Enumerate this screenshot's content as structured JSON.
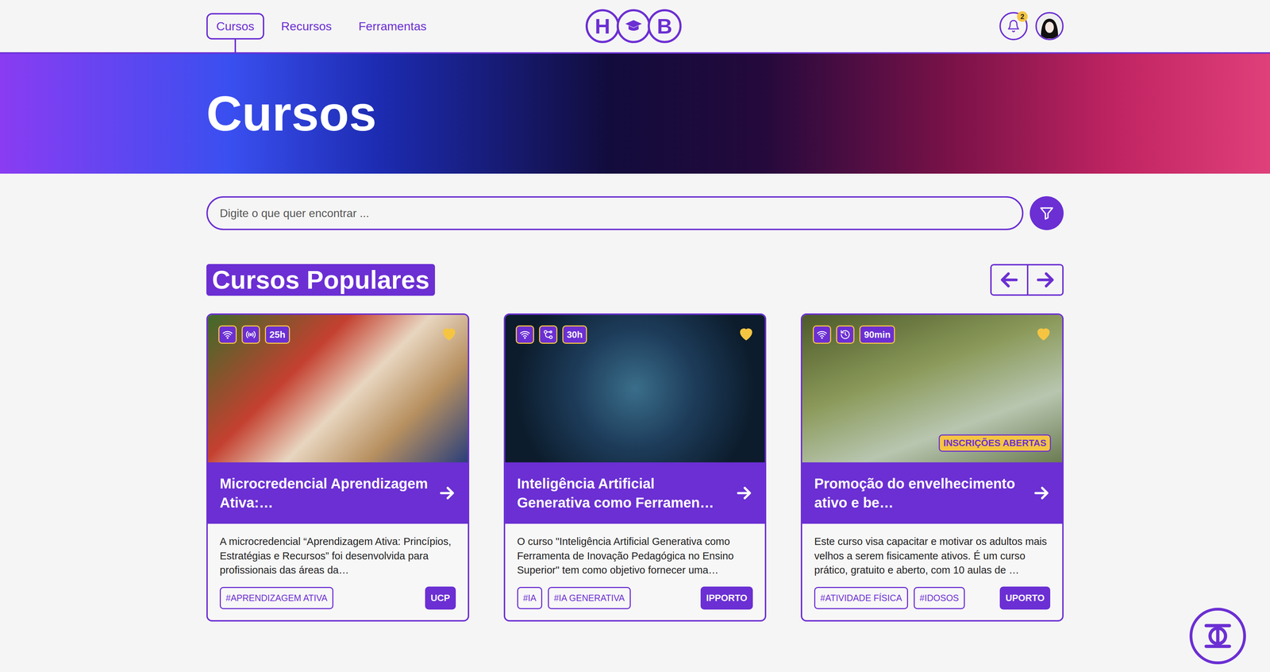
{
  "header": {
    "tabs": [
      {
        "label": "Cursos",
        "selected": true
      },
      {
        "label": "Recursos",
        "selected": false
      },
      {
        "label": "Ferramentas",
        "selected": false
      }
    ],
    "logo": {
      "left": "H",
      "right": "B"
    },
    "notifications": {
      "count": "2"
    }
  },
  "hero": {
    "title": "Cursos"
  },
  "search": {
    "placeholder": "Digite o que quer encontrar ..."
  },
  "section": {
    "title": "Cursos Populares"
  },
  "courses": [
    {
      "badges": [
        {
          "kind": "wifi",
          "text": ""
        },
        {
          "kind": "broadcast",
          "text": ""
        },
        {
          "kind": "duration",
          "text": "25h"
        }
      ],
      "favorite": true,
      "status": "",
      "title": "Microcredencial Aprendizagem Ativa:…",
      "description": "A microcredencial “Aprendizagem Ativa: Princípios, Estratégias e Recursos” foi desenvolvida para profissionais das áreas da…",
      "tags": [
        "#APRENDIZAGEM ATIVA"
      ],
      "institution": "UCP"
    },
    {
      "badges": [
        {
          "kind": "wifi",
          "text": ""
        },
        {
          "kind": "network",
          "text": ""
        },
        {
          "kind": "duration",
          "text": "30h"
        }
      ],
      "favorite": true,
      "status": "",
      "title": "Inteligência Artificial Generativa como Ferramen…",
      "description": "O curso \"Inteligência Artificial Generativa como Ferramenta de Inovação Pedagógica no Ensino Superior\" tem como objetivo fornecer uma…",
      "tags": [
        "#IA",
        "#IA GENERATIVA"
      ],
      "institution": "IPPORTO"
    },
    {
      "badges": [
        {
          "kind": "wifi",
          "text": ""
        },
        {
          "kind": "history",
          "text": ""
        },
        {
          "kind": "duration",
          "text": "90min"
        }
      ],
      "favorite": true,
      "status": "INSCRIÇÕES ABERTAS",
      "title": "Promoção do envelhecimento ativo e be…",
      "description": "Este curso visa capacitar e motivar os adultos mais velhos a serem fisicamente ativos. É um curso prático, gratuito e aberto, com 10 aulas de …",
      "tags": [
        "#ATIVIDADE FÍSICA",
        "#IDOSOS"
      ],
      "institution": "UPORTO"
    }
  ]
}
